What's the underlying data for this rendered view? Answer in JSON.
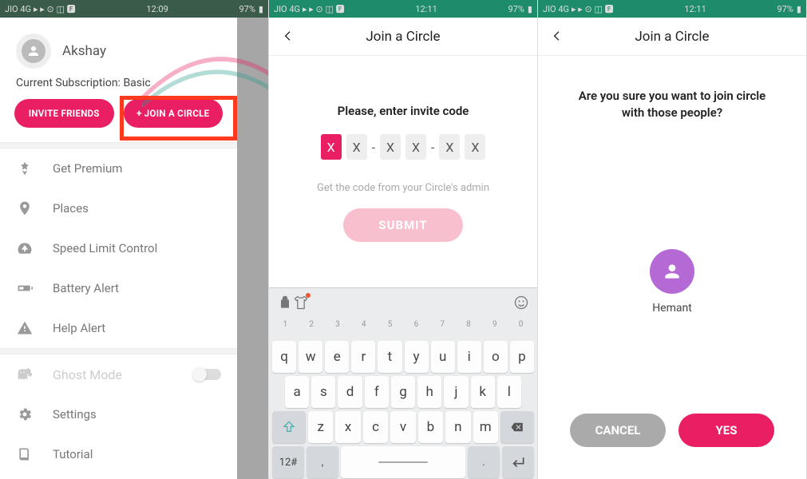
{
  "status": {
    "carrier": "JIO 4G",
    "time1": "12:09",
    "time2": "12:11",
    "time3": "12:11",
    "battery": "97%"
  },
  "screen1": {
    "profile_name": "Akshay",
    "subscription_label": "Current Subscription:",
    "subscription_value": "Basic",
    "invite_friends_label": "INVITE FRIENDS",
    "join_circle_label": "+ JOIN A CIRCLE",
    "menu": {
      "premium": "Get Premium",
      "places": "Places",
      "speed": "Speed Limit Control",
      "battery": "Battery Alert",
      "help": "Help Alert",
      "ghost": "Ghost Mode",
      "settings": "Settings",
      "tutorial": "Tutorial"
    }
  },
  "screen2": {
    "title": "Join a Circle",
    "prompt": "Please, enter invite code",
    "code_values": [
      "X",
      "X",
      "X",
      "X",
      "X",
      "X"
    ],
    "hint": "Get the code from your Circle's admin",
    "submit_label": "SUBMIT",
    "keyboard": {
      "hints": [
        "1",
        "2",
        "3",
        "4",
        "5",
        "6",
        "7",
        "8",
        "9",
        "0"
      ],
      "row1": [
        "q",
        "w",
        "e",
        "r",
        "t",
        "y",
        "u",
        "i",
        "o",
        "p"
      ],
      "row2": [
        "a",
        "s",
        "d",
        "f",
        "g",
        "h",
        "j",
        "k",
        "l"
      ],
      "row3": [
        "z",
        "x",
        "c",
        "v",
        "b",
        "n",
        "m"
      ],
      "mode": "12#"
    }
  },
  "screen3": {
    "title": "Join a Circle",
    "confirm_line1": "Are you sure you want to join circle",
    "confirm_line2": "with those people?",
    "person_name": "Hemant",
    "cancel_label": "CANCEL",
    "yes_label": "YES"
  }
}
